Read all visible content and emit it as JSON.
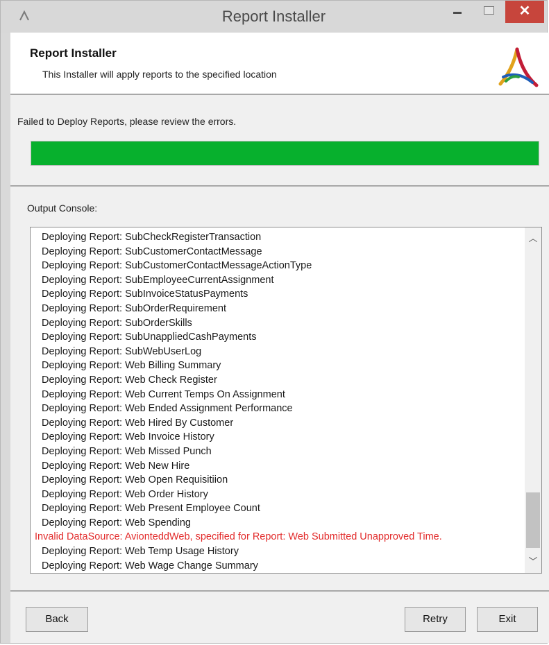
{
  "window": {
    "title": "Report Installer",
    "close_label": "✕",
    "accent_close": "#c7453c"
  },
  "header": {
    "title": "Report Installer",
    "subtitle": "This Installer will apply reports to the specified location",
    "logo_icon": "installer-logo-icon"
  },
  "status": {
    "message": "Failed to Deploy Reports, please review the errors.",
    "progress_percent": 100,
    "progress_color": "#07b02d"
  },
  "console": {
    "label": "Output Console:",
    "lines": [
      {
        "text": "Deploying Report: SubCheckRegisterTransaction",
        "error": false
      },
      {
        "text": "Deploying Report: SubCustomerContactMessage",
        "error": false
      },
      {
        "text": "Deploying Report: SubCustomerContactMessageActionType",
        "error": false
      },
      {
        "text": "Deploying Report: SubEmployeeCurrentAssignment",
        "error": false
      },
      {
        "text": "Deploying Report: SubInvoiceStatusPayments",
        "error": false
      },
      {
        "text": "Deploying Report: SubOrderRequirement",
        "error": false
      },
      {
        "text": "Deploying Report: SubOrderSkills",
        "error": false
      },
      {
        "text": "Deploying Report: SubUnappliedCashPayments",
        "error": false
      },
      {
        "text": "Deploying Report: SubWebUserLog",
        "error": false
      },
      {
        "text": "Deploying Report: Web Billing Summary",
        "error": false
      },
      {
        "text": "Deploying Report: Web Check Register",
        "error": false
      },
      {
        "text": "Deploying Report: Web Current Temps On Assignment",
        "error": false
      },
      {
        "text": "Deploying Report: Web Ended Assignment Performance",
        "error": false
      },
      {
        "text": "Deploying Report: Web Hired By Customer",
        "error": false
      },
      {
        "text": "Deploying Report: Web Invoice History",
        "error": false
      },
      {
        "text": "Deploying Report: Web Missed Punch",
        "error": false
      },
      {
        "text": "Deploying Report: Web New Hire",
        "error": false
      },
      {
        "text": "Deploying Report: Web Open Requisitiion",
        "error": false
      },
      {
        "text": "Deploying Report: Web Order History",
        "error": false
      },
      {
        "text": "Deploying Report: Web Present Employee Count",
        "error": false
      },
      {
        "text": "Deploying Report: Web Spending",
        "error": false
      },
      {
        "text": "Invalid DataSource: AvionteddWeb, specified for Report: Web Submitted Unapproved Time.",
        "error": true
      },
      {
        "text": "Deploying Report: Web Temp Usage History",
        "error": false
      },
      {
        "text": "Deploying Report: Web Wage Change Summary",
        "error": false
      }
    ],
    "error_color": "#e22b2b",
    "scroll_up_icon": "chevron-up-icon",
    "scroll_down_icon": "chevron-down-icon"
  },
  "footer": {
    "back_label": "Back",
    "retry_label": "Retry",
    "exit_label": "Exit"
  }
}
